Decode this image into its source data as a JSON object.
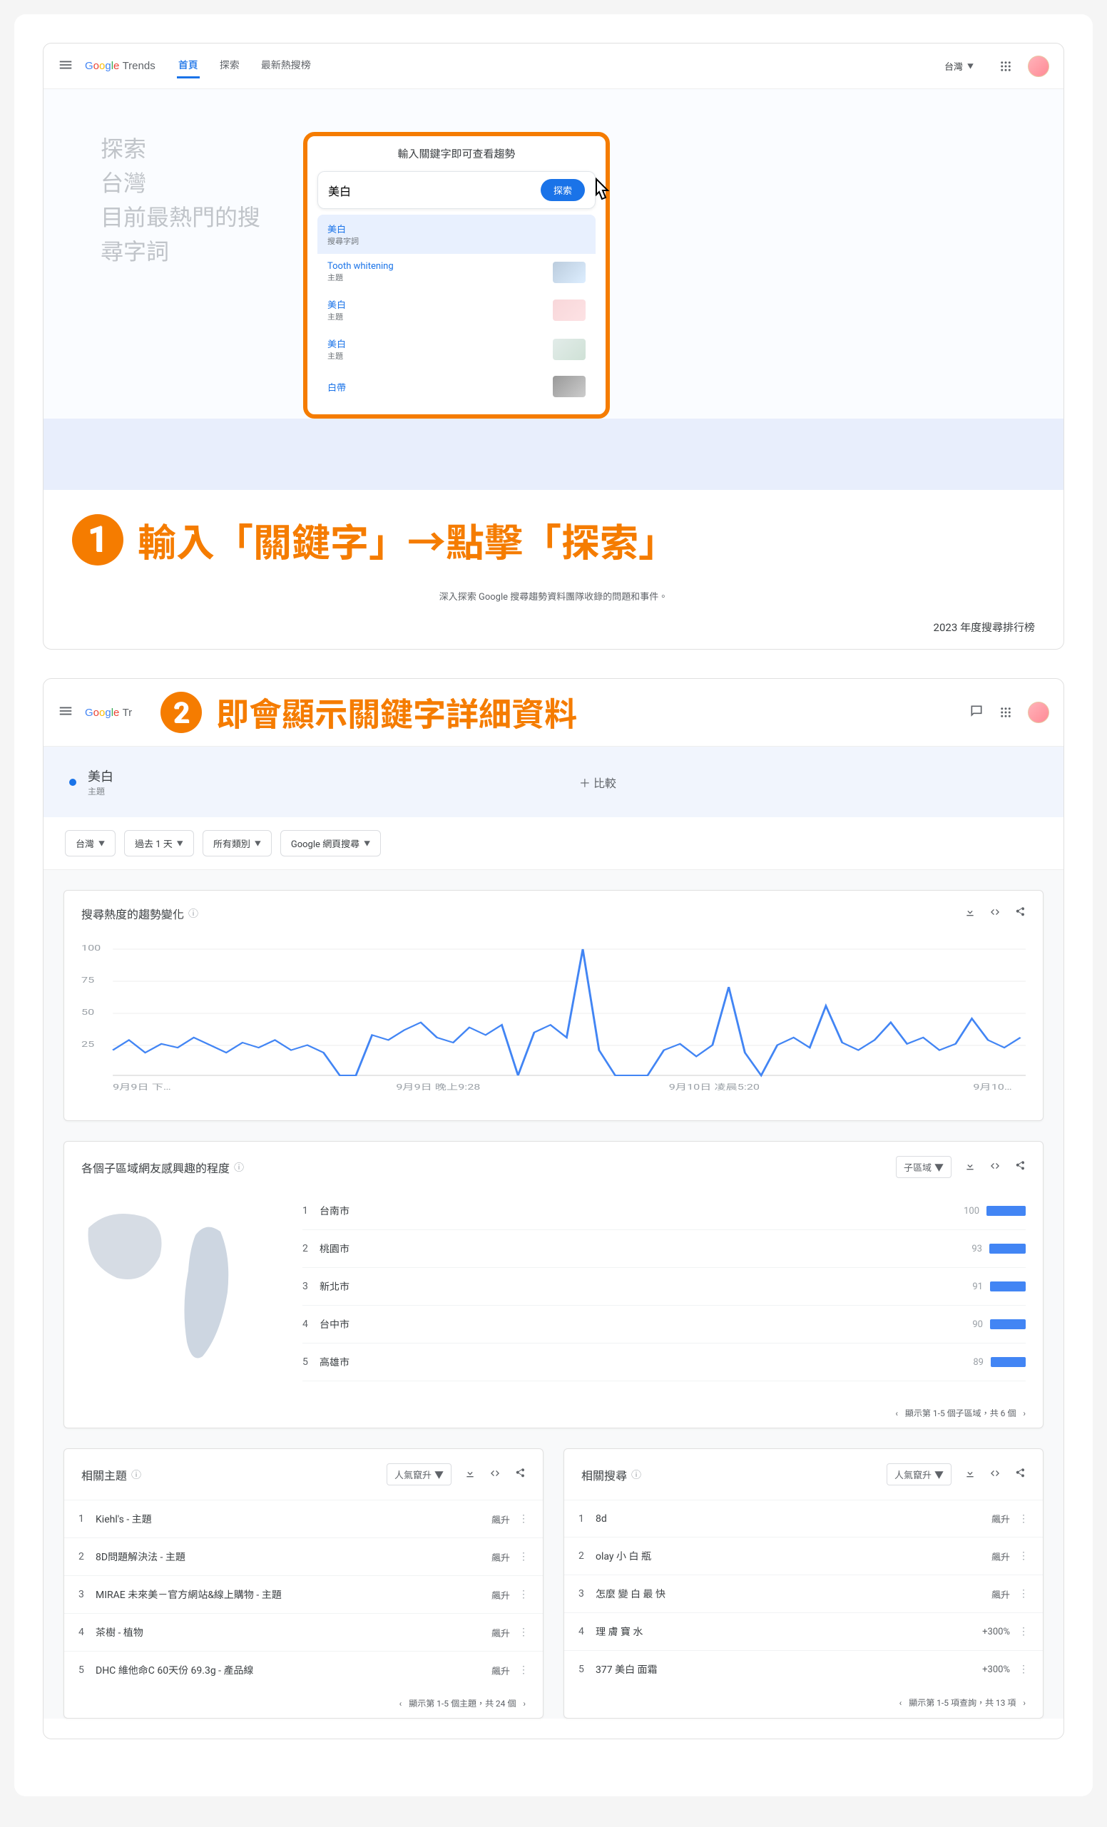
{
  "header": {
    "logo_trends": "Trends",
    "tabs": [
      "首頁",
      "探索",
      "最新熱搜榜"
    ],
    "active_tab": 0,
    "region_select": "台灣"
  },
  "hero": {
    "lines": [
      "探索",
      "台灣",
      "目前最熱門的搜",
      "尋字詞"
    ],
    "search_title": "輸入關鍵字即可查看趨勢",
    "input_value": "美白",
    "explore_btn": "探索",
    "suggestions": [
      {
        "title": "美白",
        "sub": "搜尋字詞",
        "thumb": false
      },
      {
        "title": "Tooth whitening",
        "sub": "主題",
        "thumb": true
      },
      {
        "title": "美白",
        "sub": "主題",
        "thumb": true
      },
      {
        "title": "美白",
        "sub": "主題",
        "thumb": true
      },
      {
        "title": "白帶",
        "sub": "",
        "thumb": true
      }
    ]
  },
  "annot1": "輸入「關鍵字」→點擊「探索」",
  "annot1_sub": "深入探索 Google 搜尋趨勢資料團隊收錄的問題和事件。",
  "yts_text": "2023 年度搜尋排行榜",
  "annot2": "即會顯示關鍵字詳細資料",
  "query": {
    "term": "美白",
    "type": "主題",
    "compare": "＋ 比較"
  },
  "filters": [
    "台灣",
    "過去 1 天",
    "所有類別",
    "Google 網頁搜尋"
  ],
  "interest_card": {
    "title": "搜尋熱度的趨勢變化",
    "x_ticks": [
      "9月9日 下…",
      "9月9日 晚上9:28",
      "9月10日 凌晨5:20",
      "9月10…"
    ],
    "y_ticks": [
      "25",
      "50",
      "75",
      "100"
    ]
  },
  "region_card": {
    "title": "各個子區域網友感興趣的程度",
    "select": "子區域",
    "rows": [
      {
        "name": "台南市",
        "value": 100
      },
      {
        "name": "桃園市",
        "value": 93
      },
      {
        "name": "新北市",
        "value": 91
      },
      {
        "name": "台中市",
        "value": 90
      },
      {
        "name": "高雄市",
        "value": 89
      }
    ],
    "pager": "顯示第 1-5 個子區域，共 6 個"
  },
  "related_topics": {
    "title": "相關主題",
    "select": "人氣竄升",
    "rows": [
      {
        "text": "Kiehl's - 主題",
        "value": "飆升"
      },
      {
        "text": "8D問題解決法 - 主題",
        "value": "飆升"
      },
      {
        "text": "MIRAE 未來美－官方網站&線上購物 - 主題",
        "value": "飆升"
      },
      {
        "text": "茶樹 - 植物",
        "value": "飆升"
      },
      {
        "text": "DHC 維他命C 60天份 69.3g - 產品線",
        "value": "飆升"
      }
    ],
    "pager": "顯示第 1-5 個主題，共 24 個"
  },
  "related_queries": {
    "title": "相關搜尋",
    "select": "人氣竄升",
    "rows": [
      {
        "text": "8d",
        "value": "飆升"
      },
      {
        "text": "olay 小 白 瓶",
        "value": "飆升"
      },
      {
        "text": "怎麼 變 白 最 快",
        "value": "飆升"
      },
      {
        "text": "理 膚 寶 水",
        "value": "+300%"
      },
      {
        "text": "377 美白 面霜",
        "value": "+300%"
      }
    ],
    "pager": "顯示第 1-5 項查詢，共 13 項"
  },
  "chart_data": {
    "type": "line",
    "title": "搜尋熱度的趨勢變化",
    "ylim": [
      0,
      100
    ],
    "x_ticks": [
      "9月9日 下…",
      "9月9日 晚上9:28",
      "9月10日 凌晨5:20",
      "9月10…"
    ],
    "series": [
      {
        "name": "美白",
        "values": [
          20,
          28,
          18,
          25,
          22,
          30,
          24,
          18,
          26,
          22,
          28,
          20,
          24,
          18,
          0,
          0,
          32,
          28,
          36,
          42,
          30,
          26,
          38,
          32,
          40,
          0,
          34,
          40,
          30,
          100,
          20,
          0,
          0,
          0,
          20,
          25,
          15,
          24,
          70,
          18,
          0,
          24,
          30,
          22,
          55,
          26,
          20,
          28,
          42,
          25,
          30,
          20,
          25,
          45,
          28,
          22,
          30
        ]
      }
    ]
  }
}
